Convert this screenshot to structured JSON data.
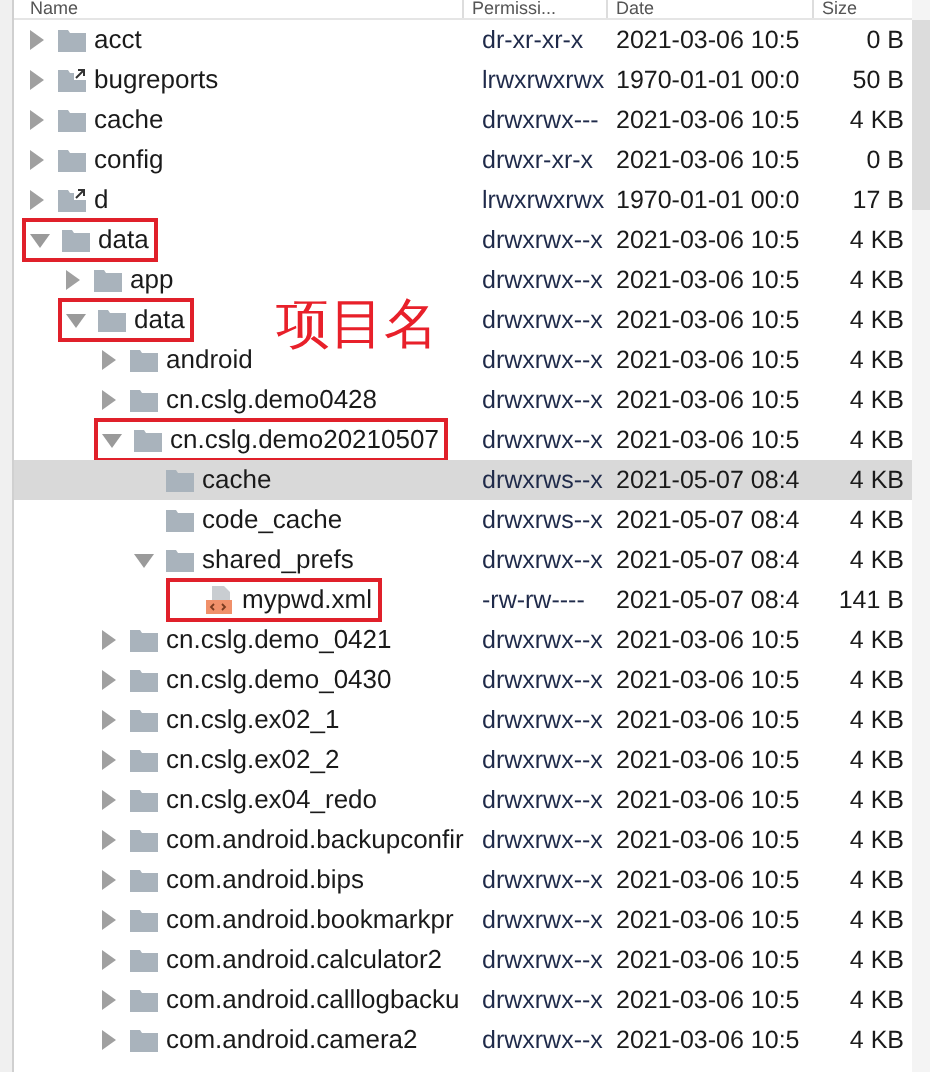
{
  "columns": [
    "Name",
    "Permissi...",
    "Date",
    "Size"
  ],
  "annotation": "项目名",
  "tree": [
    {
      "name": "acct",
      "kind": "folder",
      "expanded": false,
      "selected": false,
      "highlighted": false,
      "permissions": "dr-xr-xr-x",
      "date": "2021-03-06 10:5",
      "size": "0 B"
    },
    {
      "name": "bugreports",
      "kind": "link",
      "expanded": false,
      "selected": false,
      "highlighted": false,
      "permissions": "lrwxrwxrwx",
      "date": "1970-01-01 00:0",
      "size": "50 B"
    },
    {
      "name": "cache",
      "kind": "folder",
      "expanded": false,
      "selected": false,
      "highlighted": false,
      "permissions": "drwxrwx---",
      "date": "2021-03-06 10:5",
      "size": "4 KB"
    },
    {
      "name": "config",
      "kind": "folder",
      "expanded": false,
      "selected": false,
      "highlighted": false,
      "permissions": "drwxr-xr-x",
      "date": "2021-03-06 10:5",
      "size": "0 B"
    },
    {
      "name": "d",
      "kind": "link",
      "expanded": false,
      "selected": false,
      "highlighted": false,
      "permissions": "lrwxrwxrwx",
      "date": "1970-01-01 00:0",
      "size": "17 B"
    },
    {
      "name": "data",
      "kind": "folder",
      "expanded": true,
      "selected": false,
      "highlighted": true,
      "permissions": "drwxrwx--x",
      "date": "2021-03-06 10:5",
      "size": "4 KB",
      "children": [
        {
          "name": "app",
          "kind": "folder",
          "expanded": false,
          "selected": false,
          "highlighted": false,
          "permissions": "drwxrwx--x",
          "date": "2021-03-06 10:5",
          "size": "4 KB"
        },
        {
          "name": "data",
          "kind": "folder",
          "expanded": true,
          "selected": false,
          "highlighted": true,
          "permissions": "drwxrwx--x",
          "date": "2021-03-06 10:5",
          "size": "4 KB",
          "children": [
            {
              "name": "android",
              "kind": "folder",
              "expanded": false,
              "selected": false,
              "highlighted": false,
              "permissions": "drwxrwx--x",
              "date": "2021-03-06 10:5",
              "size": "4 KB"
            },
            {
              "name": "cn.cslg.demo0428",
              "kind": "folder",
              "expanded": false,
              "selected": false,
              "highlighted": false,
              "permissions": "drwxrwx--x",
              "date": "2021-03-06 10:5",
              "size": "4 KB"
            },
            {
              "name": "cn.cslg.demo20210507",
              "kind": "folder",
              "expanded": true,
              "selected": false,
              "highlighted": true,
              "permissions": "drwxrwx--x",
              "date": "2021-03-06 10:5",
              "size": "4 KB",
              "children": [
                {
                  "name": "cache",
                  "kind": "folder",
                  "selected": true,
                  "highlighted": false,
                  "permissions": "drwxrws--x",
                  "date": "2021-05-07 08:4",
                  "size": "4 KB"
                },
                {
                  "name": "code_cache",
                  "kind": "folder",
                  "selected": false,
                  "highlighted": false,
                  "permissions": "drwxrws--x",
                  "date": "2021-05-07 08:4",
                  "size": "4 KB"
                },
                {
                  "name": "shared_prefs",
                  "kind": "folder",
                  "expanded": true,
                  "selected": false,
                  "highlighted": false,
                  "permissions": "drwxrwx--x",
                  "date": "2021-05-07 08:4",
                  "size": "4 KB",
                  "children": [
                    {
                      "name": "mypwd.xml",
                      "kind": "file",
                      "selected": false,
                      "highlighted": true,
                      "permissions": "-rw-rw----",
                      "date": "2021-05-07 08:4",
                      "size": "141 B"
                    }
                  ]
                }
              ]
            },
            {
              "name": "cn.cslg.demo_0421",
              "kind": "folder",
              "expanded": false,
              "selected": false,
              "highlighted": false,
              "permissions": "drwxrwx--x",
              "date": "2021-03-06 10:5",
              "size": "4 KB"
            },
            {
              "name": "cn.cslg.demo_0430",
              "kind": "folder",
              "expanded": false,
              "selected": false,
              "highlighted": false,
              "permissions": "drwxrwx--x",
              "date": "2021-03-06 10:5",
              "size": "4 KB"
            },
            {
              "name": "cn.cslg.ex02_1",
              "kind": "folder",
              "expanded": false,
              "selected": false,
              "highlighted": false,
              "permissions": "drwxrwx--x",
              "date": "2021-03-06 10:5",
              "size": "4 KB"
            },
            {
              "name": "cn.cslg.ex02_2",
              "kind": "folder",
              "expanded": false,
              "selected": false,
              "highlighted": false,
              "permissions": "drwxrwx--x",
              "date": "2021-03-06 10:5",
              "size": "4 KB"
            },
            {
              "name": "cn.cslg.ex04_redo",
              "kind": "folder",
              "expanded": false,
              "selected": false,
              "highlighted": false,
              "permissions": "drwxrwx--x",
              "date": "2021-03-06 10:5",
              "size": "4 KB"
            },
            {
              "name": "com.android.backupconfir",
              "kind": "folder",
              "expanded": false,
              "selected": false,
              "highlighted": false,
              "permissions": "drwxrwx--x",
              "date": "2021-03-06 10:5",
              "size": "4 KB"
            },
            {
              "name": "com.android.bips",
              "kind": "folder",
              "expanded": false,
              "selected": false,
              "highlighted": false,
              "permissions": "drwxrwx--x",
              "date": "2021-03-06 10:5",
              "size": "4 KB"
            },
            {
              "name": "com.android.bookmarkpr",
              "kind": "folder",
              "expanded": false,
              "selected": false,
              "highlighted": false,
              "permissions": "drwxrwx--x",
              "date": "2021-03-06 10:5",
              "size": "4 KB"
            },
            {
              "name": "com.android.calculator2",
              "kind": "folder",
              "expanded": false,
              "selected": false,
              "highlighted": false,
              "permissions": "drwxrwx--x",
              "date": "2021-03-06 10:5",
              "size": "4 KB"
            },
            {
              "name": "com.android.calllogbacku",
              "kind": "folder",
              "expanded": false,
              "selected": false,
              "highlighted": false,
              "permissions": "drwxrwx--x",
              "date": "2021-03-06 10:5",
              "size": "4 KB"
            },
            {
              "name": "com.android.camera2",
              "kind": "folder",
              "expanded": false,
              "selected": false,
              "highlighted": false,
              "permissions": "drwxrwx--x",
              "date": "2021-03-06 10:5",
              "size": "4 KB"
            }
          ]
        }
      ]
    }
  ]
}
